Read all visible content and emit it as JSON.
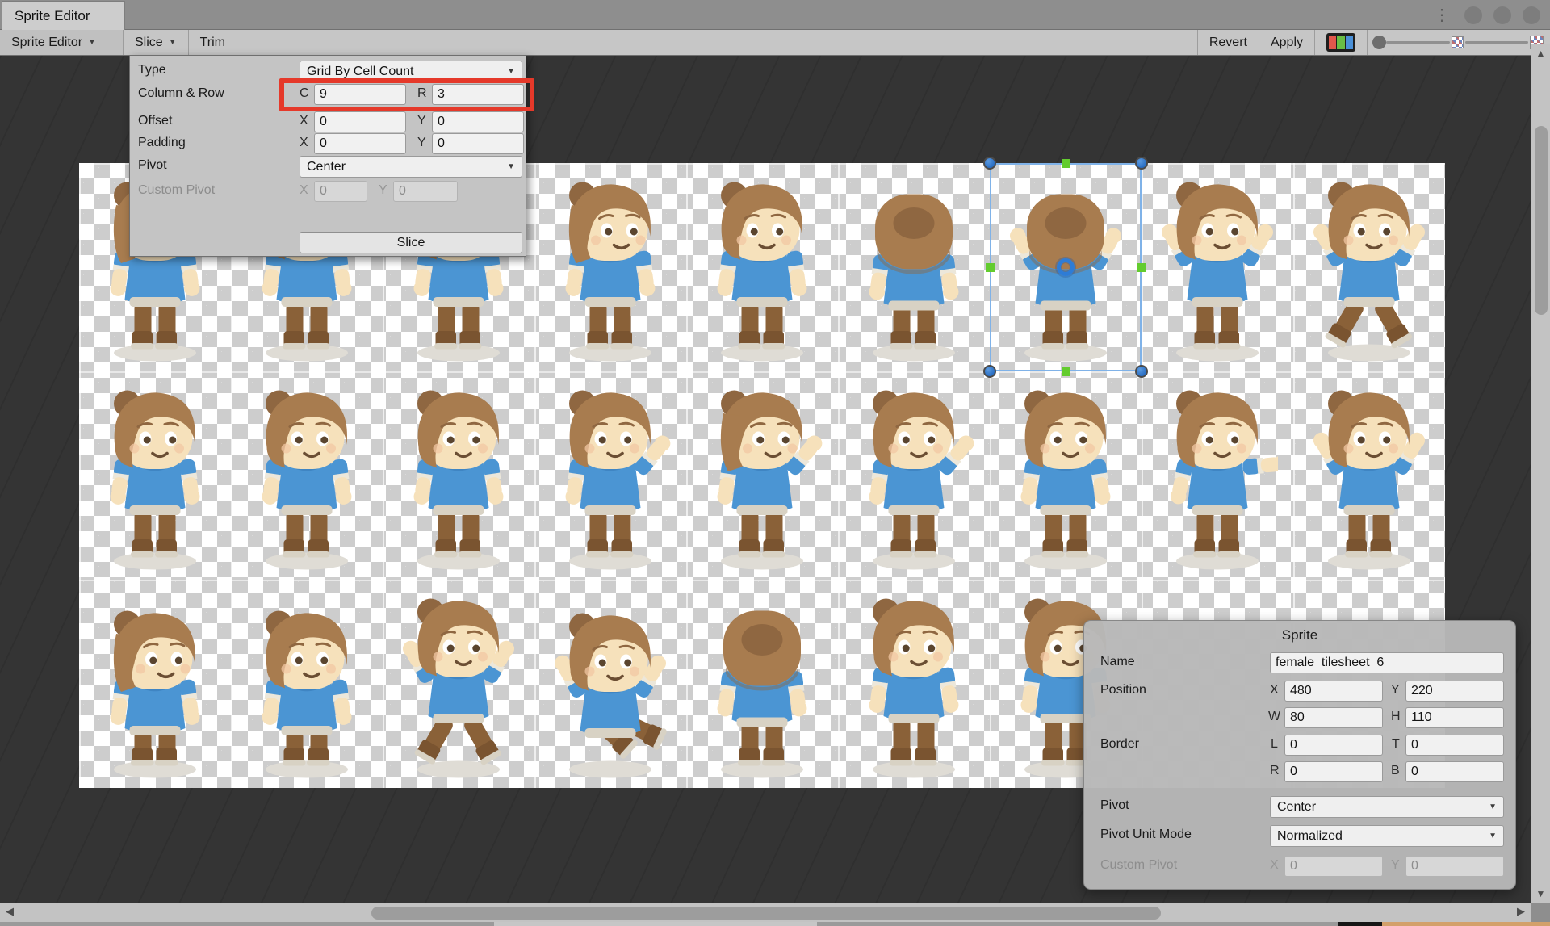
{
  "window": {
    "tab_title": "Sprite Editor"
  },
  "icons": {
    "dropdown_arrow": "▼",
    "more_vertical": "⋮",
    "scroll_left": "◀",
    "scroll_right": "▶",
    "scroll_up": "▲",
    "scroll_down": "▼"
  },
  "toolbar": {
    "sprite_editor_menu": "Sprite Editor",
    "slice_menu": "Slice",
    "trim_button": "Trim",
    "revert_button": "Revert",
    "apply_button": "Apply"
  },
  "slice_panel": {
    "type": {
      "label": "Type",
      "value": "Grid By Cell Count"
    },
    "column_row": {
      "label": "Column & Row",
      "c_label": "C",
      "c_value": "9",
      "r_label": "R",
      "r_value": "3"
    },
    "offset": {
      "label": "Offset",
      "x_label": "X",
      "x_value": "0",
      "y_label": "Y",
      "y_value": "0"
    },
    "padding": {
      "label": "Padding",
      "x_label": "X",
      "x_value": "0",
      "y_label": "Y",
      "y_value": "0"
    },
    "pivot": {
      "label": "Pivot",
      "value": "Center"
    },
    "custom_pivot": {
      "label": "Custom Pivot",
      "x_label": "X",
      "x_value": "0",
      "y_label": "Y",
      "y_value": "0"
    },
    "slice_button": "Slice"
  },
  "sprite_info_panel": {
    "title": "Sprite",
    "name": {
      "label": "Name",
      "value": "female_tilesheet_6"
    },
    "position": {
      "label": "Position",
      "x_label": "X",
      "x_value": "480",
      "y_label": "Y",
      "y_value": "220",
      "w_label": "W",
      "w_value": "80",
      "h_label": "H",
      "h_value": "110"
    },
    "border": {
      "label": "Border",
      "l_label": "L",
      "l_value": "0",
      "t_label": "T",
      "t_value": "0",
      "r_label": "R",
      "r_value": "0",
      "b_label": "B",
      "b_value": "0"
    },
    "pivot": {
      "label": "Pivot",
      "value": "Center"
    },
    "pivot_unit_mode": {
      "label": "Pivot Unit Mode",
      "value": "Normalized"
    },
    "custom_pivot": {
      "label": "Custom Pivot",
      "x_label": "X",
      "x_value": "0",
      "y_label": "Y",
      "y_value": "0"
    }
  },
  "sprite_grid": {
    "columns": 9,
    "rows": 3,
    "cell_texture_w": 80,
    "cell_texture_h": 110,
    "selected": {
      "row": 0,
      "col": 6
    },
    "poses": [
      [
        "walk-side",
        "front",
        "front",
        "side",
        "front-look",
        "back-bend",
        "back-up",
        "front-up",
        "jump"
      ],
      [
        "front",
        "front",
        "front",
        "wave",
        "side-wave",
        "wave",
        "front",
        "front-reach",
        "front-up"
      ],
      [
        "side-crouch",
        "crouch",
        "jump",
        "sit",
        "back-bend",
        "front",
        "front"
      ]
    ]
  },
  "colors": {
    "highlight_red": "#e5392a",
    "selection_blue": "#2e7cd6",
    "handle_green": "#63cc2e",
    "hair": "#a87c4f",
    "hair_dark": "#8f6741",
    "skin": "#f6e1bb",
    "shirt": "#4b95d3",
    "shirt_dark": "#3d83c0",
    "pants": "#8a6138",
    "boots": "#7a5430",
    "sole": "#d8d2c4",
    "shadow": "#dfdcd5",
    "canvas_bg": "#343434",
    "checker_gray": "#cdcdcd"
  }
}
